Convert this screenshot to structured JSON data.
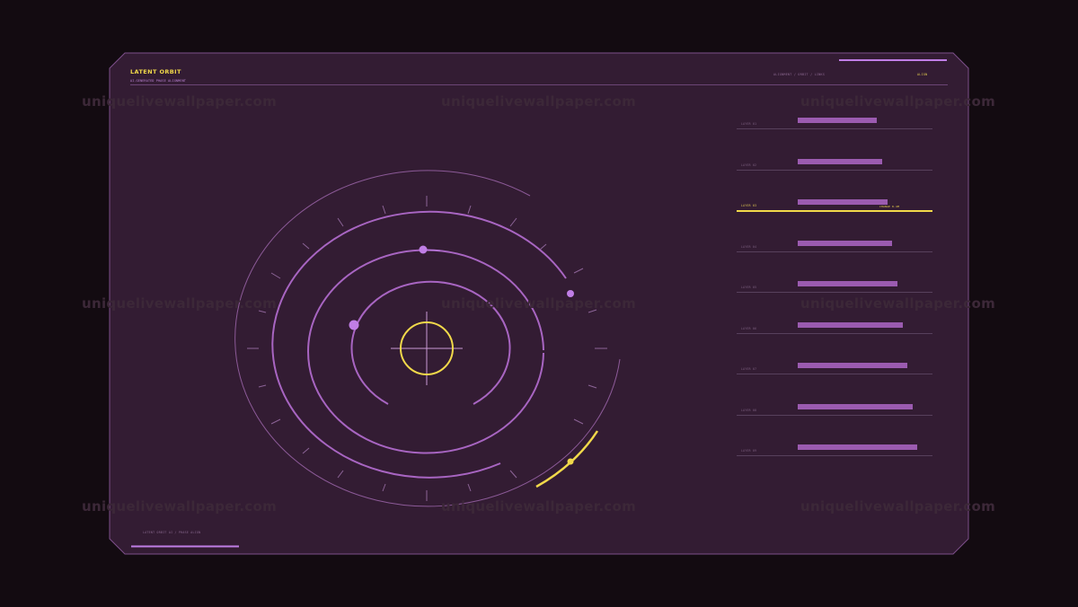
{
  "header": {
    "title": "LATENT ORBIT",
    "subtitle": "AI-GENERATED PHASE ALIGNMENT",
    "mode": "ALIGNMENT / ORBIT / LINKS",
    "status": "ALIGN"
  },
  "footer": {
    "caption": "LATENT ORBIT AI / PHASE ALIGN"
  },
  "colors": {
    "background": "#130b11",
    "panel": "#331c33",
    "panel_border": "#7d4f8a",
    "accent": "#c07ee6",
    "highlight": "#f1d94a"
  },
  "orbit": {
    "rings": 4,
    "planets": 4,
    "active_ring": 4
  },
  "rows": [
    {
      "label": "LAYER 01",
      "value": 0.52,
      "highlight": false
    },
    {
      "label": "LAYER 02",
      "value": 0.55,
      "highlight": false
    },
    {
      "label": "LAYER 03",
      "value": 0.59,
      "highlight": true,
      "note": "CHANGE 8.4M"
    },
    {
      "label": "LAYER 04",
      "value": 0.62,
      "highlight": false
    },
    {
      "label": "LAYER 05",
      "value": 0.65,
      "highlight": false
    },
    {
      "label": "LAYER 06",
      "value": 0.69,
      "highlight": false
    },
    {
      "label": "LAYER 07",
      "value": 0.72,
      "highlight": false
    },
    {
      "label": "LAYER 08",
      "value": 0.75,
      "highlight": false
    },
    {
      "label": "LAYER 09",
      "value": 0.78,
      "highlight": false
    }
  ],
  "watermark": "uniquelivewallpaper.com"
}
